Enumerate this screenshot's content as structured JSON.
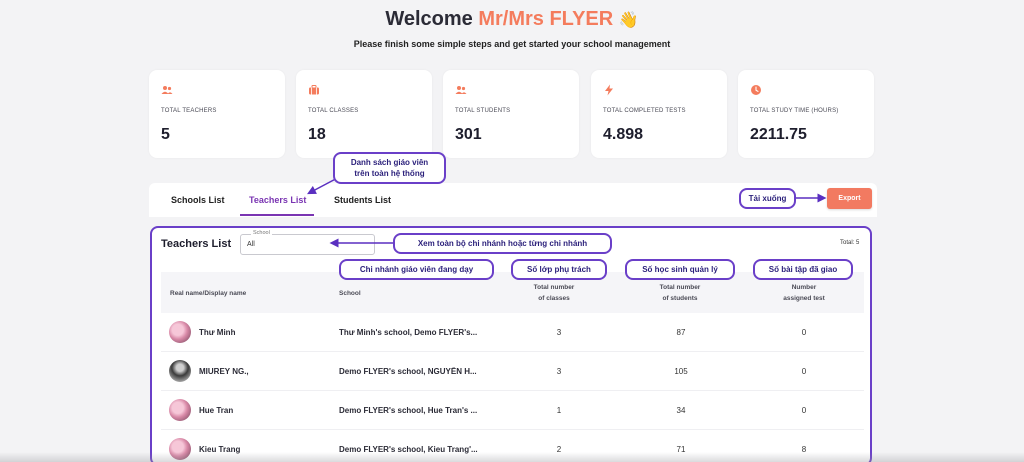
{
  "header": {
    "welcome_prefix": "Welcome",
    "user_name": "Mr/Mrs FLYER",
    "wave": "👋",
    "subtitle": "Please finish some simple steps and get started your school management"
  },
  "stats": [
    {
      "icon": "users-icon",
      "label": "TOTAL TEACHERS",
      "value": "5"
    },
    {
      "icon": "briefcase-icon",
      "label": "TOTAL CLASSES",
      "value": "18"
    },
    {
      "icon": "users-icon",
      "label": "TOTAL STUDENTS",
      "value": "301"
    },
    {
      "icon": "bolt-icon",
      "label": "TOTAL COMPLETED TESTS",
      "value": "4.898"
    },
    {
      "icon": "clock-icon",
      "label": "TOTAL STUDY TIME (HOURS)",
      "value": "2211.75"
    }
  ],
  "tabs": [
    {
      "label": "Schools List",
      "active": false
    },
    {
      "label": "Teachers List",
      "active": true
    },
    {
      "label": "Students List",
      "active": false
    }
  ],
  "export_label": "Export",
  "section": {
    "title": "Teachers List",
    "school_filter_legend": "School",
    "school_filter_value": "All",
    "total": "Total: 5"
  },
  "table": {
    "headers": {
      "name": "Real name/Display name",
      "school": "School",
      "classes_l1": "Total number",
      "classes_l2": "of classes",
      "students_l1": "Total number",
      "students_l2": "of students",
      "tests_l1": "Number",
      "tests_l2": "assigned test"
    },
    "rows": [
      {
        "name": "Thư Minh",
        "school": "Thư Minh's school, Demo FLYER's...",
        "classes": "3",
        "students": "87",
        "tests": "0",
        "avatar": "pink"
      },
      {
        "name": "MIUREY NG.,",
        "school": "Demo FLYER's school, NGUYỄN H...",
        "classes": "3",
        "students": "105",
        "tests": "0",
        "avatar": "dark"
      },
      {
        "name": "Hue Tran",
        "school": "Demo FLYER's school, Hue Tran's ...",
        "classes": "1",
        "students": "34",
        "tests": "0",
        "avatar": "pink"
      },
      {
        "name": "Kieu Trang",
        "school": "Demo FLYER's school, Kieu Trang'...",
        "classes": "2",
        "students": "71",
        "tests": "8",
        "avatar": "pink"
      }
    ]
  },
  "annotations": {
    "teachers_list_note_l1": "Danh sách giáo viên",
    "teachers_list_note_l2": "trên toàn hệ thống",
    "download_note": "Tải xuống",
    "filter_note": "Xem toàn bộ chi nhánh hoặc từng chi nhánh",
    "school_note": "Chi nhánh giáo viên đang dạy",
    "classes_note": "Số lớp phụ trách",
    "students_note": "Số học sinh quản lý",
    "tests_note": "Số bài tập đã giao"
  },
  "colors": {
    "accent_orange": "#f47c5d",
    "accent_purple": "#7a35b2",
    "annotation_border": "#6a3fc8",
    "export_bg": "#f27a61"
  }
}
